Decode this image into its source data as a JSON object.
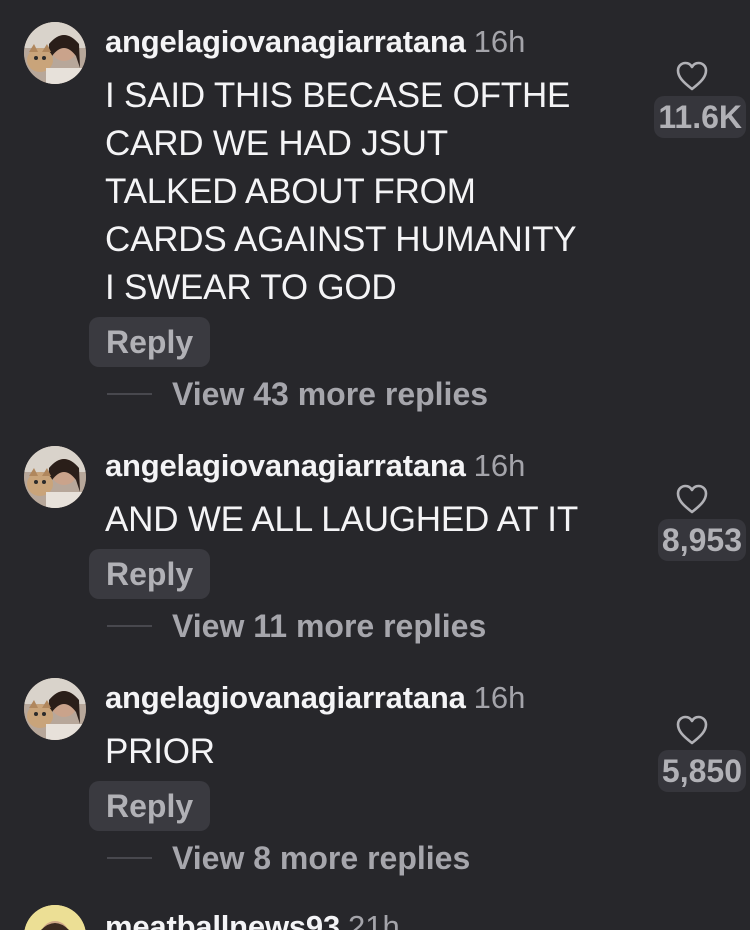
{
  "comments": [
    {
      "username": "angelagiovanagiarratana",
      "time": "16h",
      "text": "I SAID THIS BECASE OFTHE\nCARD WE HAD JSUT\nTALKED ABOUT FROM\nCARDS AGAINST HUMANITY\nI SWEAR TO GOD",
      "likes": "11.6K",
      "reply_label": "Reply",
      "view_replies": "View 43 more replies"
    },
    {
      "username": "angelagiovanagiarratana",
      "time": "16h",
      "text": "AND WE ALL LAUGHED AT IT",
      "likes": "8,953",
      "reply_label": "Reply",
      "view_replies": "View 11 more replies"
    },
    {
      "username": "angelagiovanagiarratana",
      "time": "16h",
      "text": "PRIOR",
      "likes": "5,850",
      "reply_label": "Reply",
      "view_replies": "View 8 more replies"
    }
  ],
  "next_comment": {
    "username": "meatballnews93",
    "time": "21h"
  },
  "colors": {
    "background": "#27272b",
    "text": "#f4f4f6",
    "muted": "#a6a6ac",
    "button_bg": "#3a3a40"
  },
  "icons": {
    "like": "heart-icon"
  }
}
